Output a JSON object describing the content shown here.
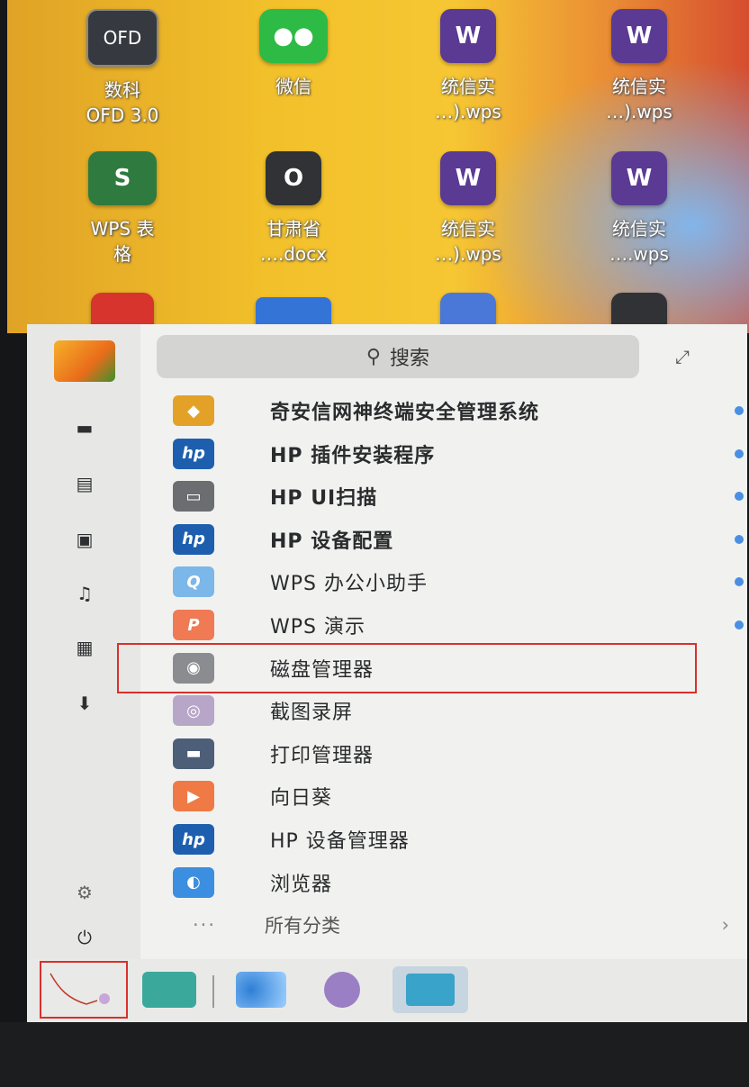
{
  "desktop": {
    "icons": [
      {
        "name": "ofd-icon",
        "tile": "OFD",
        "label": "数科\nOFD 3.0",
        "cls": "ofd"
      },
      {
        "name": "wechat-icon",
        "tile": "●●",
        "label": "微信",
        "cls": "wechat"
      },
      {
        "name": "wps-writer-icon",
        "tile": "W",
        "label": "统信实\n…).wps",
        "cls": "wps-w"
      },
      {
        "name": "wps-writer-icon",
        "tile": "W",
        "label": "统信实\n…).wps",
        "cls": "wps-w"
      },
      {
        "name": "wps-sheet-icon",
        "tile": "S",
        "label": "WPS 表\n格",
        "cls": "sheet"
      },
      {
        "name": "office-doc-icon",
        "tile": "O",
        "label": "甘肃省\n….docx",
        "cls": "office"
      },
      {
        "name": "wps-writer-icon",
        "tile": "W",
        "label": "统信实\n…).wps",
        "cls": "wps-w"
      },
      {
        "name": "wps-writer-icon",
        "tile": "W",
        "label": "统信实\n….wps",
        "cls": "wps-w"
      }
    ]
  },
  "menu": {
    "search_placeholder": "搜索",
    "apps": [
      {
        "label": "奇安信网神终端安全管理系统",
        "icon": "qianxin-icon",
        "bold": true,
        "dot": true,
        "color": "#e4a127",
        "glyph": "◆"
      },
      {
        "label": "HP 插件安装程序",
        "icon": "hp-icon",
        "bold": true,
        "dot": true,
        "color": "#1d5fae",
        "glyph": "hp"
      },
      {
        "label": "HP UI扫描",
        "icon": "scanner-icon",
        "bold": true,
        "dot": true,
        "color": "#6b6d70",
        "glyph": "▭"
      },
      {
        "label": "HP 设备配置",
        "icon": "hp-icon",
        "bold": true,
        "dot": true,
        "color": "#1d5fae",
        "glyph": "hp"
      },
      {
        "label": "WPS 办公小助手",
        "icon": "wps-assistant-icon",
        "bold": false,
        "dot": true,
        "color": "#7bb7e8",
        "glyph": "Q"
      },
      {
        "label": "WPS 演示",
        "icon": "wps-presentation-icon",
        "bold": false,
        "dot": true,
        "color": "#ef7a54",
        "glyph": "P"
      },
      {
        "label": "磁盘管理器",
        "icon": "disk-manager-icon",
        "bold": false,
        "dot": false,
        "color": "#8a8c8f",
        "glyph": "◉"
      },
      {
        "label": "截图录屏",
        "icon": "screenshot-icon",
        "bold": false,
        "dot": false,
        "color": "#b8a6c8",
        "glyph": "◎"
      },
      {
        "label": "打印管理器",
        "icon": "printer-icon",
        "bold": false,
        "dot": false,
        "color": "#4c5e78",
        "glyph": "▬"
      },
      {
        "label": "向日葵",
        "icon": "sunlogin-icon",
        "bold": false,
        "dot": false,
        "color": "#ef7a45",
        "glyph": "▶"
      },
      {
        "label": "HP 设备管理器",
        "icon": "hp-icon",
        "bold": false,
        "dot": false,
        "color": "#1d5fae",
        "glyph": "hp"
      },
      {
        "label": "浏览器",
        "icon": "browser-icon",
        "bold": false,
        "dot": false,
        "color": "#3c8ee0",
        "glyph": "◐"
      }
    ],
    "all_categories": "所有分类"
  },
  "taskbar": {
    "items": [
      "launcher-icon",
      "file-manager-icon",
      "browser-icon",
      "screenshot-icon",
      "app-store-icon"
    ]
  },
  "colors": {
    "highlight": "#d9302c",
    "dot": "#4a90e2"
  }
}
